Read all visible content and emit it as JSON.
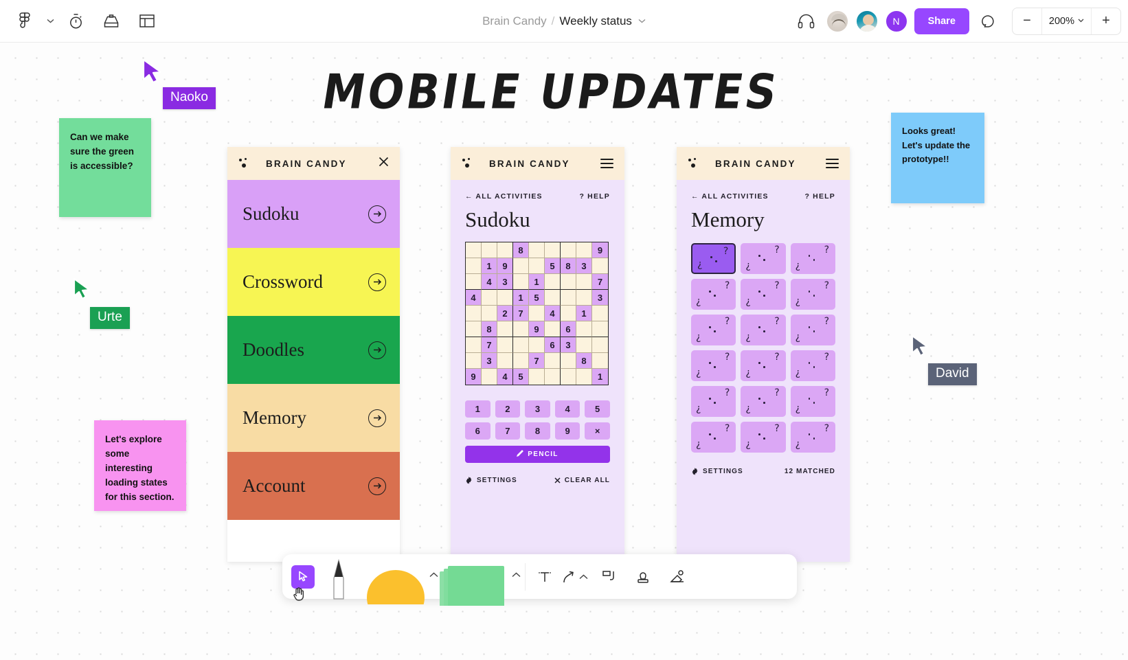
{
  "topbar": {
    "menu_icon": "figma-logo-icon",
    "menu_caret": "chevron-down-icon",
    "tools": [
      "timer-icon",
      "inbox-icon",
      "layout-icon"
    ],
    "breadcrumb": {
      "project": "Brain Candy",
      "separator": "/",
      "page": "Weekly status",
      "caret": "chevron-down-icon"
    },
    "headphones_icon": "headphones-icon",
    "avatars": [
      {
        "name": "avatar-photo-1",
        "type": "photo"
      },
      {
        "name": "avatar-photo-2",
        "type": "photo"
      },
      {
        "name": "avatar-initial",
        "type": "initial",
        "initial": "N",
        "color": "#8d35f0"
      }
    ],
    "share_label": "Share",
    "comment_icon": "comment-bubble-icon",
    "zoom": {
      "minus": "−",
      "value": "200%",
      "caret": "chevron-down-icon",
      "plus": "+"
    }
  },
  "canvas": {
    "board_title": "MOBILE UPDATES",
    "sticky_notes": [
      {
        "name": "sticky-note-green",
        "text": "Can we make sure the green is accessible?",
        "color": "#73dd9b"
      },
      {
        "name": "sticky-note-pink",
        "text": "Let's explore some interesting loading states for this section.",
        "color": "#f893f0"
      },
      {
        "name": "sticky-note-blue",
        "text": "Looks great! Let's update the prototype!!",
        "color": "#7ecbfa"
      }
    ],
    "cursors": [
      {
        "name": "cursor-naoko",
        "label": "Naoko",
        "color": "#8a2be2"
      },
      {
        "name": "cursor-urte",
        "label": "Urte",
        "color": "#1aa053"
      },
      {
        "name": "cursor-david",
        "label": "David",
        "color": "#5b6378"
      }
    ]
  },
  "phone_menu": {
    "brand": "BRAIN CANDY",
    "header_icon": "close-icon",
    "items": [
      {
        "label": "Sudoku",
        "color": "#d9a0f7"
      },
      {
        "label": "Crossword",
        "color": "#f7f553"
      },
      {
        "label": "Doodles",
        "color": "#19a64e"
      },
      {
        "label": "Memory",
        "color": "#f8dca4"
      },
      {
        "label": "Account",
        "color": "#d9704f"
      }
    ]
  },
  "phone_sudoku": {
    "brand": "BRAIN CANDY",
    "header_icon": "hamburger-menu-icon",
    "back_label": "← ALL ACTIVITIES",
    "help_label": "? HELP",
    "title": "Sudoku",
    "grid": [
      [
        0,
        0,
        0,
        8,
        0,
        0,
        0,
        0,
        9
      ],
      [
        0,
        1,
        9,
        0,
        0,
        5,
        8,
        3,
        0
      ],
      [
        0,
        4,
        3,
        0,
        1,
        0,
        0,
        0,
        7
      ],
      [
        4,
        0,
        0,
        1,
        5,
        0,
        0,
        0,
        3
      ],
      [
        0,
        0,
        2,
        7,
        0,
        4,
        0,
        1,
        0
      ],
      [
        0,
        8,
        0,
        0,
        9,
        0,
        6,
        0,
        0
      ],
      [
        0,
        7,
        0,
        0,
        0,
        6,
        3,
        0,
        0
      ],
      [
        0,
        3,
        0,
        0,
        7,
        0,
        0,
        8,
        0
      ],
      [
        9,
        0,
        4,
        5,
        0,
        0,
        0,
        0,
        1
      ]
    ],
    "numpad_row1": [
      "1",
      "2",
      "3",
      "4",
      "5"
    ],
    "numpad_row2": [
      "6",
      "7",
      "8",
      "9",
      "×"
    ],
    "pencil_label": "PENCIL",
    "pencil_icon": "pencil-icon",
    "settings_label": "SETTINGS",
    "settings_icon": "gear-icon",
    "clear_label": "CLEAR ALL",
    "clear_icon": "close-icon"
  },
  "phone_memory": {
    "brand": "BRAIN CANDY",
    "header_icon": "hamburger-menu-icon",
    "back_label": "← ALL ACTIVITIES",
    "help_label": "? HELP",
    "title": "Memory",
    "card_glyph_left": "¿",
    "card_glyph_right": "?",
    "card_count": 18,
    "active_card_index": 0,
    "settings_label": "SETTINGS",
    "settings_icon": "gear-icon",
    "matched_label": "12 MATCHED"
  },
  "bottom_toolbar": {
    "select_icon": "cursor-select-icon",
    "hand_icon": "hand-pan-icon",
    "pen_icon": "pen-tool-icon",
    "shape_icon": "shape-ellipse-icon",
    "shape_caret": "chevron-up-icon",
    "note_icon": "sticky-note-icon",
    "note_caret": "chevron-up-icon",
    "text_icon": "text-tool-icon",
    "connector_icon": "connector-arrow-icon",
    "connector_caret": "chevron-up-icon",
    "frame_icon": "frame-icon",
    "stamp_icon": "stamp-icon",
    "widget_icon": "widget-icon"
  }
}
